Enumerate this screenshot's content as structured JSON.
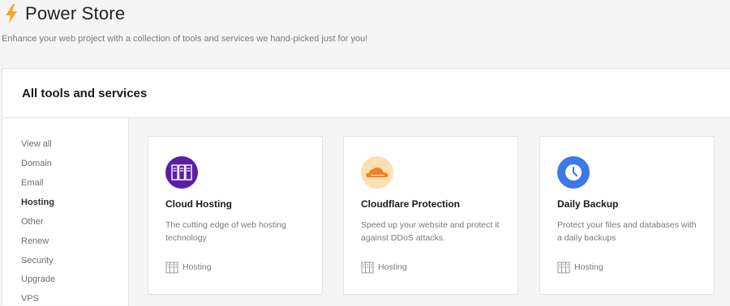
{
  "header": {
    "title": "Power Store",
    "subtitle": "Enhance your web project with a collection of tools and services we hand-picked just for you!"
  },
  "panel": {
    "title": "All tools and services"
  },
  "sidebar": {
    "items": [
      {
        "label": "View all",
        "active": false
      },
      {
        "label": "Domain",
        "active": false
      },
      {
        "label": "Email",
        "active": false
      },
      {
        "label": "Hosting",
        "active": true
      },
      {
        "label": "Other",
        "active": false
      },
      {
        "label": "Renew",
        "active": false
      },
      {
        "label": "Security",
        "active": false
      },
      {
        "label": "Upgrade",
        "active": false
      },
      {
        "label": "VPS",
        "active": false
      }
    ]
  },
  "cards": [
    {
      "name": "Cloud Hosting",
      "description": "The cutting edge of web hosting technology",
      "category": "Hosting",
      "icon": "server-icon",
      "icon_bg": "#5b1fa6"
    },
    {
      "name": "Cloudflare Protection",
      "description": "Speed up your website and protect it against DDoS attacks.",
      "category": "Hosting",
      "icon": "cloudflare-icon",
      "icon_bg": "#fde0b0"
    },
    {
      "name": "Daily Backup",
      "description": "Protect your files and databases with a daily backups",
      "category": "Hosting",
      "icon": "clock-icon",
      "icon_bg": "#3d78e8"
    }
  ],
  "colors": {
    "bolt": "#f5a623",
    "page_bg": "#f5f5f5"
  }
}
